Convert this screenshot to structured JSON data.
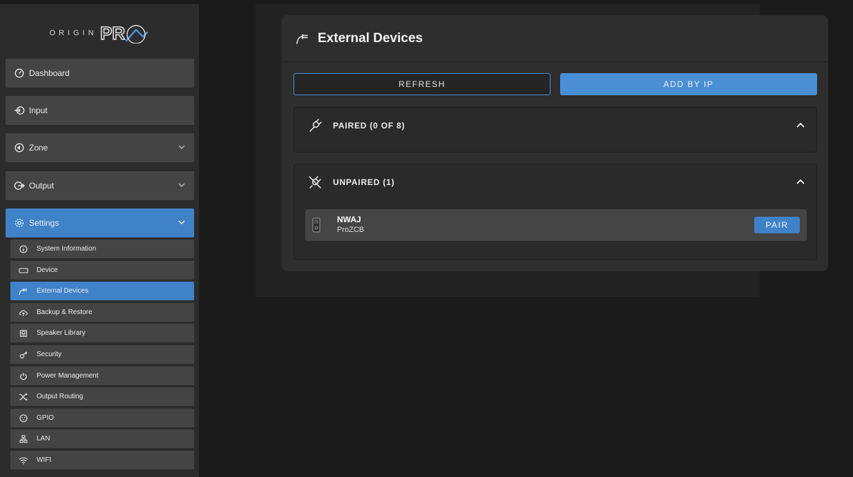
{
  "brand": {
    "logo_text": "ORIGIN",
    "logo_mark_text": "PR",
    "accent_color": "#3f82c8"
  },
  "sidebar": {
    "nav": [
      {
        "label": "Dashboard",
        "icon": "gauge-icon",
        "has_chevron": false
      },
      {
        "label": "Input",
        "icon": "input-icon",
        "has_chevron": false
      },
      {
        "label": "Zone",
        "icon": "speaker-icon",
        "has_chevron": true
      },
      {
        "label": "Output",
        "icon": "output-icon",
        "has_chevron": true
      },
      {
        "label": "Settings",
        "icon": "gear-icon",
        "has_chevron": true,
        "active": true
      }
    ],
    "settings_items": [
      {
        "label": "System Information",
        "icon": "info-icon"
      },
      {
        "label": "Device",
        "icon": "device-icon"
      },
      {
        "label": "External Devices",
        "icon": "plug-icon",
        "active": true
      },
      {
        "label": "Backup & Restore",
        "icon": "cloud-upload-icon"
      },
      {
        "label": "Speaker Library",
        "icon": "library-icon"
      },
      {
        "label": "Security",
        "icon": "key-icon"
      },
      {
        "label": "Power Management",
        "icon": "power-icon"
      },
      {
        "label": "Output Routing",
        "icon": "routing-icon"
      },
      {
        "label": "GPIO",
        "icon": "gpio-icon"
      },
      {
        "label": "LAN",
        "icon": "lan-icon"
      },
      {
        "label": "WIFI",
        "icon": "wifi-icon"
      }
    ]
  },
  "panel": {
    "title": "External Devices",
    "refresh_label": "REFRESH",
    "add_by_ip_label": "ADD BY IP",
    "paired": {
      "label": "PAIRED (0 OF 8)"
    },
    "unpaired": {
      "label": "UNPAIRED (1)",
      "devices": [
        {
          "name": "NWAJ",
          "model": "ProZCB",
          "action_label": "PAIR"
        }
      ]
    }
  }
}
